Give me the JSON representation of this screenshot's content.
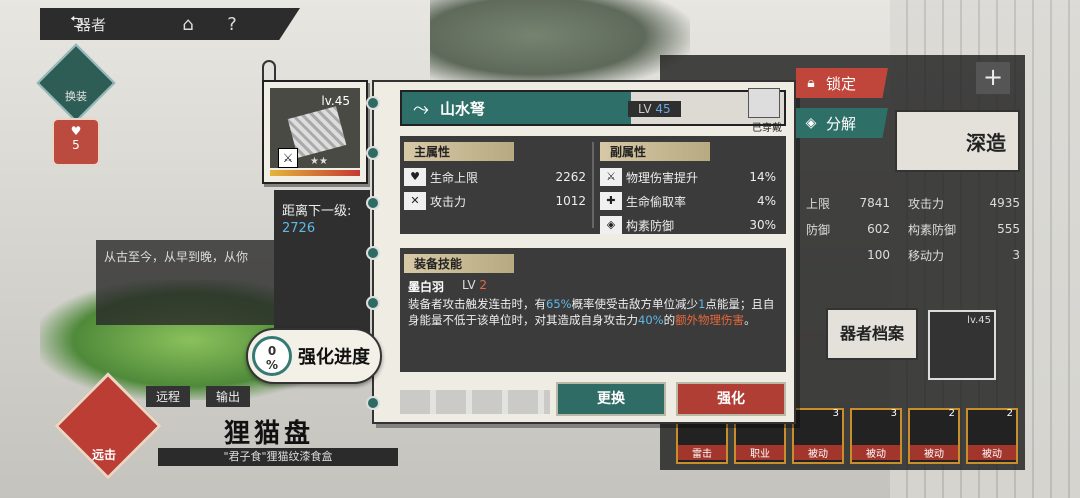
{
  "topbar": {
    "back_label": "器者",
    "home_icon": "home-icon",
    "help_label": "?"
  },
  "left": {
    "swap_label": "换装",
    "heart_count": "5",
    "dialog": "从古至今，从早到晚，从你",
    "upgrade": {
      "percent": "0",
      "percent_sign": "%",
      "label": "强化进度"
    },
    "tags": [
      "远程",
      "输出"
    ],
    "weapon_badge": "远击",
    "title": "狸猫盘",
    "subtitle": "\"君子食\"狸猫纹漆食盒"
  },
  "weapon_card": {
    "level": "lv.45",
    "star_label": "★★"
  },
  "next_level": {
    "label": "距离下一级:",
    "value": "2726"
  },
  "panel": {
    "name": "山水弩",
    "lv_label": "LV",
    "lv_value": "45",
    "equipped": "已穿戴",
    "main_attr_title": "主属性",
    "main_attrs": [
      {
        "icon": "heart-icon",
        "name": "生命上限",
        "value": "2262"
      },
      {
        "icon": "swords-icon",
        "name": "攻击力",
        "value": "1012"
      }
    ],
    "sub_attr_title": "副属性",
    "sub_attrs": [
      {
        "icon": "damage-up-icon",
        "name": "物理伤害提升",
        "value": "14%"
      },
      {
        "icon": "lifesteal-icon",
        "name": "生命偷取率",
        "value": "4%"
      },
      {
        "icon": "defense-icon",
        "name": "构素防御",
        "value": "30%"
      }
    ],
    "skill_title": "装备技能",
    "skill_name": "墨白羽",
    "skill_lv_label": "LV",
    "skill_lv_value": "2",
    "skill_desc_1": "装备者攻击触发连击时，有",
    "skill_hl_1": "65%",
    "skill_desc_2": "概率使受击敌方单位减少",
    "skill_hl_2": "1",
    "skill_desc_3": "点能量；且自身能量不低于该单位时，对其造成自身攻击力",
    "skill_hl_3": "40%",
    "skill_desc_4": "的",
    "skill_hl_4": "额外物理伤害",
    "skill_desc_5": "。",
    "change_label": "更换",
    "enhance_label": "强化"
  },
  "right": {
    "lock_label": "锁定",
    "decompose_label": "分解",
    "deep_label": "深造",
    "stats": [
      {
        "n1": "上限",
        "v1": "7841",
        "n2": "攻击力",
        "v2": "4935"
      },
      {
        "n1": "防御",
        "v1": "602",
        "n2": "构素防御",
        "v2": "555"
      },
      {
        "n1": "",
        "v1": "100",
        "n2": "移动力",
        "v2": "3"
      }
    ],
    "archive_label": "器者档案",
    "mini_card_level": "lv.45",
    "slots": [
      {
        "label": "雷击",
        "num": ""
      },
      {
        "label": "职业",
        "num": ""
      },
      {
        "label": "被动",
        "num": "3"
      },
      {
        "label": "被动",
        "num": "3"
      },
      {
        "label": "被动",
        "num": "2"
      },
      {
        "label": "被动",
        "num": "2"
      }
    ]
  },
  "colors": {
    "teal": "#2e7069",
    "red": "#b13e34",
    "blue_highlight": "#5fb8e6",
    "orange_highlight": "#e8673b"
  }
}
